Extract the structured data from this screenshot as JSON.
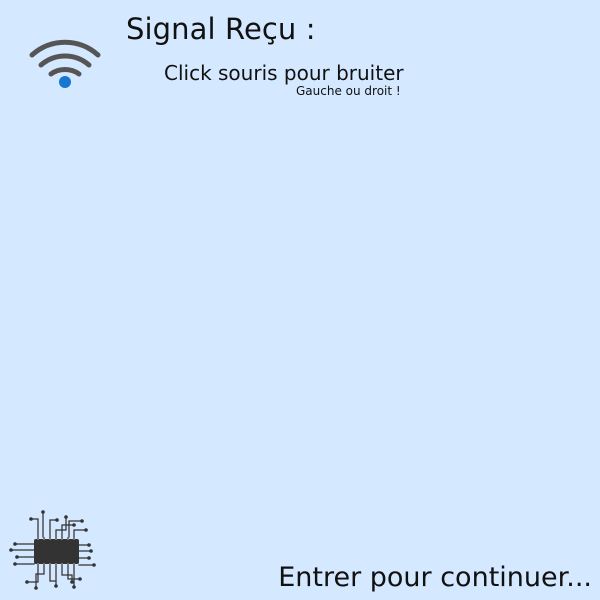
{
  "screen": {
    "title": "Signal Reçu :",
    "instruction": "Click souris pour bruiter",
    "button_hint": "Gauche ou droit !",
    "continue_prompt": "Entrer pour continuer..."
  },
  "icons": {
    "signal": "wifi-icon",
    "device": "chip-icon"
  },
  "colors": {
    "background": "#d4e8ff",
    "text": "#111111",
    "wifi_waves": "#555555",
    "wifi_dot": "#1677d2",
    "chip": "#333333"
  }
}
